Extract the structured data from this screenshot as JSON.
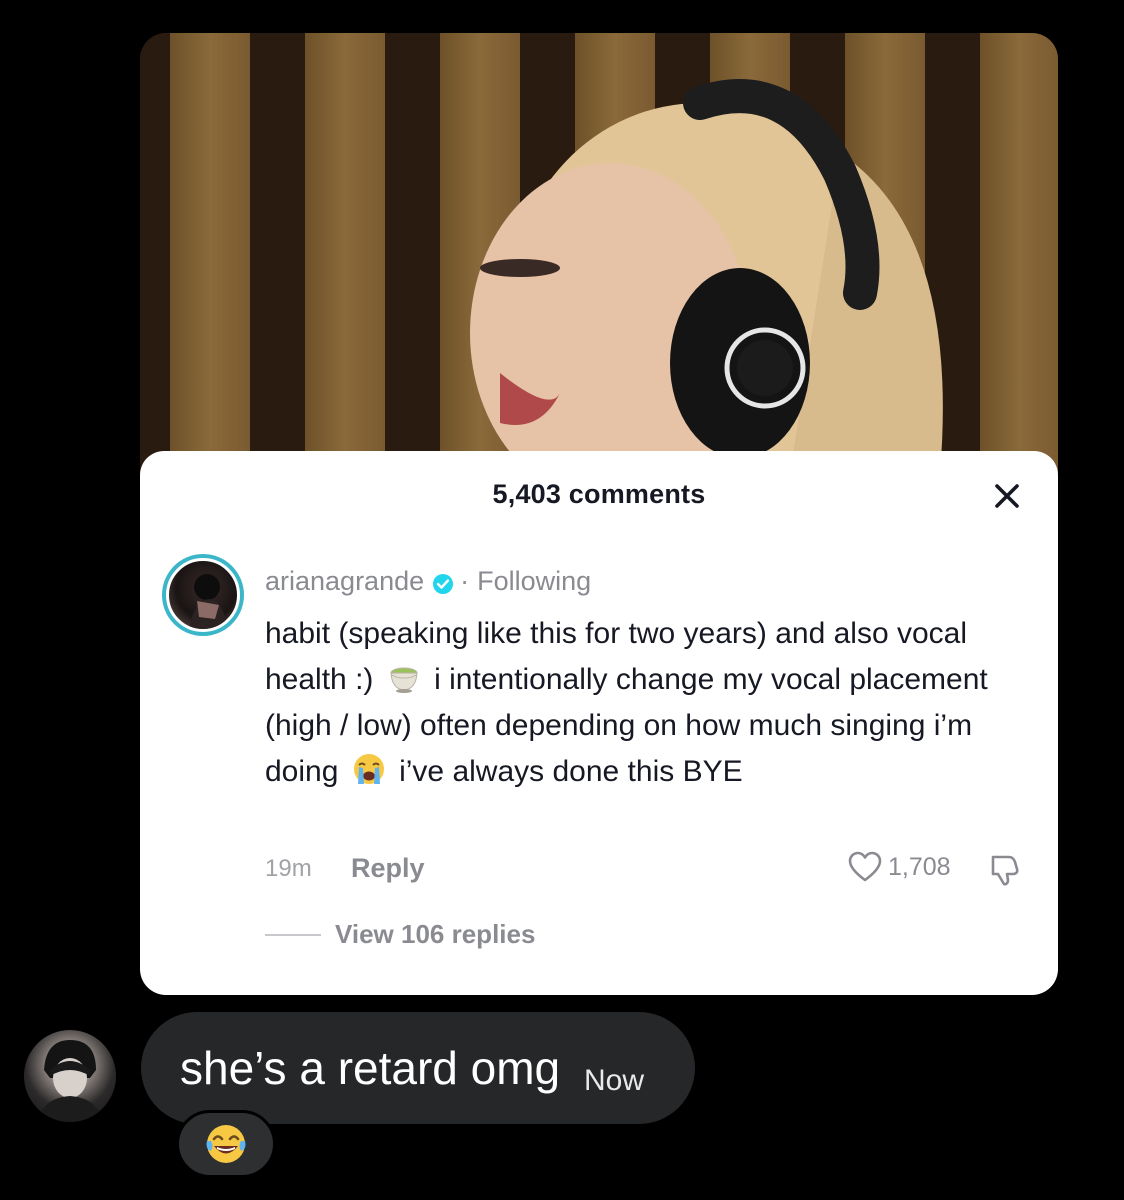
{
  "sheet": {
    "title": "5,403 comments",
    "close_icon": "close-icon"
  },
  "comment": {
    "username": "arianagrande",
    "separator": "·",
    "follow_status": "Following",
    "text_part1": "habit (speaking like this for two years) and also vocal health :)",
    "emoji1": "matcha-tea-icon",
    "text_part2": "i intentionally change my vocal placement (high / low) often depending on how much singing i’m doing",
    "emoji2": "loudly-crying-face-icon",
    "text_part3": "i’ve always done this BYE",
    "time_ago": "19m",
    "reply_label": "Reply",
    "like_count": "1,708",
    "view_replies_label": "View 106 replies"
  },
  "message": {
    "text": "she’s a retard omg",
    "time": "Now",
    "reaction_icon": "face-with-tears-of-joy-icon"
  },
  "colors": {
    "background": "#000000",
    "bubble": "#262729",
    "sheet": "#ffffff",
    "verified_badge": "#20d5ec",
    "muted_text": "#8a8b91"
  }
}
